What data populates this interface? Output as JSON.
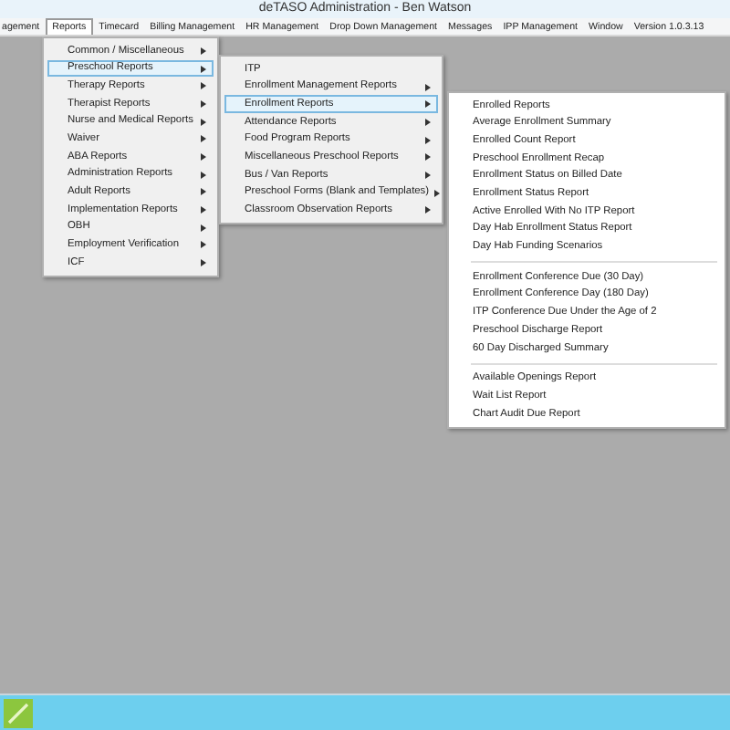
{
  "window": {
    "title": "deTASO Administration - Ben Watson"
  },
  "menu_bar": [
    {
      "label": "agement",
      "selected": false
    },
    {
      "label": "Reports",
      "selected": true
    },
    {
      "label": "Timecard",
      "selected": false
    },
    {
      "label": "Billing Management",
      "selected": false
    },
    {
      "label": "HR Management",
      "selected": false
    },
    {
      "label": "Drop Down Management",
      "selected": false
    },
    {
      "label": "Messages",
      "selected": false
    },
    {
      "label": "IPP Management",
      "selected": false
    },
    {
      "label": "Window",
      "selected": false
    },
    {
      "label": "Version 1.0.3.13",
      "selected": false
    }
  ],
  "reports_menu": [
    {
      "label": "Common / Miscellaneous",
      "submenu": true,
      "selected": false
    },
    {
      "label": "Preschool Reports",
      "submenu": true,
      "selected": true
    },
    {
      "label": "Therapy Reports",
      "submenu": true,
      "selected": false
    },
    {
      "label": "Therapist Reports",
      "submenu": true,
      "selected": false
    },
    {
      "label": "Nurse and Medical Reports",
      "submenu": true,
      "selected": false
    },
    {
      "label": "Waiver",
      "submenu": true,
      "selected": false
    },
    {
      "label": "ABA Reports",
      "submenu": true,
      "selected": false
    },
    {
      "label": "Administration Reports",
      "submenu": true,
      "selected": false
    },
    {
      "label": "Adult Reports",
      "submenu": true,
      "selected": false
    },
    {
      "label": "Implementation Reports",
      "submenu": true,
      "selected": false
    },
    {
      "label": "OBH",
      "submenu": true,
      "selected": false
    },
    {
      "label": "Employment Verification",
      "submenu": true,
      "selected": false
    },
    {
      "label": "ICF",
      "submenu": true,
      "selected": false
    }
  ],
  "preschool_menu": [
    {
      "label": "ITP",
      "submenu": false,
      "selected": false
    },
    {
      "label": "Enrollment Management Reports",
      "submenu": true,
      "selected": false
    },
    {
      "label": "Enrollment Reports",
      "submenu": true,
      "selected": true
    },
    {
      "label": "Attendance Reports",
      "submenu": true,
      "selected": false
    },
    {
      "label": "Food Program Reports",
      "submenu": true,
      "selected": false
    },
    {
      "label": "Miscellaneous Preschool Reports",
      "submenu": true,
      "selected": false
    },
    {
      "label": "Bus / Van Reports",
      "submenu": true,
      "selected": false
    },
    {
      "label": "Preschool Forms (Blank and Templates)",
      "submenu": true,
      "selected": false
    },
    {
      "label": "Classroom Observation Reports",
      "submenu": true,
      "selected": false
    }
  ],
  "enrollment_menu": [
    [
      "Enrolled Reports",
      "Average Enrollment Summary",
      "Enrolled Count Report",
      "Preschool Enrollment Recap",
      "Enrollment Status on Billed Date",
      "Enrollment Status Report",
      "Active Enrolled With No ITP Report",
      "Day Hab Enrollment Status Report",
      "Day Hab Funding Scenarios"
    ],
    [
      "Enrollment Conference Due (30 Day)",
      "Enrollment Conference Day (180 Day)",
      "ITP Conference Due Under the Age of 2",
      "Preschool Discharge Report",
      "60 Day Discharged Summary"
    ],
    [
      "Available Openings Report",
      "Wait List Report",
      "Chart Audit Due Report"
    ]
  ]
}
